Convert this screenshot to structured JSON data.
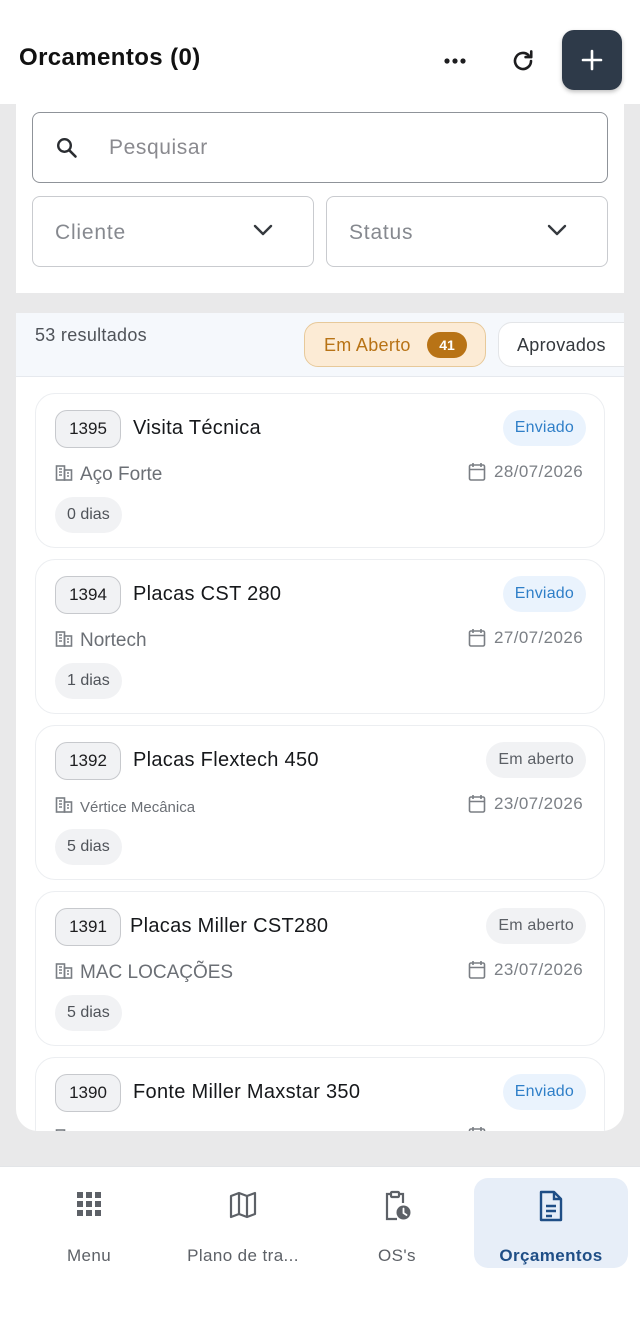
{
  "header": {
    "title": "Orcamentos (0)",
    "more_icon": "more-horizontal-icon",
    "refresh_icon": "refresh-icon",
    "add_icon": "plus-icon",
    "add_button_color": "#2e3a49"
  },
  "filters": {
    "search_placeholder": "Pesquisar",
    "client_select": "Cliente",
    "status_select": "Status"
  },
  "results": {
    "count_label": "53 resultados",
    "chips": [
      {
        "label": "Em Aberto",
        "count": "41",
        "active": true
      },
      {
        "label": "Aprovados",
        "active": false
      }
    ]
  },
  "quotes": [
    {
      "number": "1395",
      "title": "Visita Técnica",
      "status": "Enviado",
      "status_type": "sent",
      "client": "Aço Forte",
      "date": "28/07/2026",
      "days": "0 dias"
    },
    {
      "number": "1394",
      "title": "Placas CST 280",
      "status": "Enviado",
      "status_type": "sent",
      "client": "Nortech",
      "date": "27/07/2026",
      "days": "1 dias"
    },
    {
      "number": "1392",
      "title": "Placas Flextech 450",
      "status": "Em aberto",
      "status_type": "open",
      "client": "Vértice Mecânica",
      "date": "23/07/2026",
      "days": "5 dias"
    },
    {
      "number": "1391",
      "title": "Placas Miller CST280",
      "status": "Em aberto",
      "status_type": "open",
      "client": "MAC LOCAÇÕES",
      "date": "23/07/2026",
      "days": "5 dias"
    },
    {
      "number": "1390",
      "title": "Fonte Miller Maxstar 350",
      "status": "Enviado",
      "status_type": "sent"
    }
  ],
  "colors": {
    "accent_open": "#b87316",
    "status_sent": "#2f7fc8",
    "nav_active_bg": "#e7eef8"
  },
  "bottom_nav": [
    {
      "label": "Menu",
      "icon": "grid-icon"
    },
    {
      "label": "Plano de tra...",
      "icon": "map-icon"
    },
    {
      "label": "OS's",
      "icon": "clipboard-clock-icon"
    },
    {
      "label": "Orçamentos",
      "icon": "document-icon",
      "active": true
    }
  ]
}
